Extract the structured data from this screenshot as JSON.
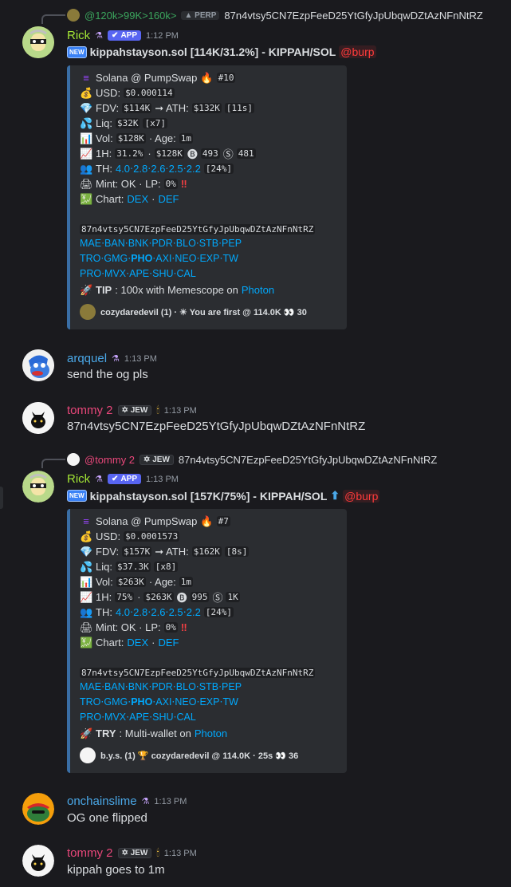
{
  "reply1": {
    "author": "@120k>99K>160k>",
    "badge": "PERP",
    "content": "87n4vtsy5CN7EzpFeeD25YtGfyJpUbqwDZtAzNFnNtRZ"
  },
  "msg1": {
    "author": "Rick",
    "badge": "APP",
    "time": "1:12 PM",
    "title_new": "NEW",
    "title": "kippahstayson.sol [114K/31.2%] - KIPPAH/SOL",
    "mention": "@burp",
    "embed": {
      "source": "Solana @ PumpSwap",
      "rank": "#10",
      "usd_label": "USD:",
      "usd": "$0.000114",
      "fdv_label": "FDV:",
      "fdv": "$114K",
      "ath_label": "➞ ATH:",
      "ath": "$132K",
      "ath_ago": "[11s]",
      "liq_label": "Liq:",
      "liq": "$32K",
      "liq_x": "[x7]",
      "vol_label": "Vol:",
      "vol": "$128K",
      "age_label": "· Age:",
      "age": "1m",
      "h1_label": "1H:",
      "h1_pct": "31.2%",
      "h1_vol": "$128K",
      "buys": "493",
      "sells": "481",
      "th_label": "TH:",
      "th": "4.0⋅2.8⋅2.6⋅2.5⋅2.2",
      "th_total": "[24%]",
      "mint_label": "Mint: OK · LP:",
      "lp": "0%",
      "chart_label": "Chart:",
      "dex": "DEX",
      "def": "DEF",
      "address": "87n4vtsy5CN7EzpFeeD25YtGfyJpUbqwDZtAzNFnNtRZ",
      "links1": "MAE⋅BAN⋅BNK⋅PDR⋅BLO⋅STB⋅PEP",
      "links2a": "TRO⋅GMG⋅",
      "links2b": "PHO",
      "links2c": "⋅AXI⋅NEO⋅EXP⋅TW",
      "links3": "PRO⋅MVX⋅APE⋅SHU⋅CAL",
      "tip_label": "TIP",
      "tip_text": ": 100x with Memescope on",
      "tip_link": "Photon",
      "footer": "cozydaredevil (1) · ☀ You are first @ 114.0K 👀 30"
    }
  },
  "msg2": {
    "author": "arqquel",
    "time": "1:13 PM",
    "content": "send the og pls"
  },
  "msg3": {
    "author": "tommy 2",
    "badge": "JEW",
    "time": "1:13 PM",
    "content": "87n4vtsy5CN7EzpFeeD25YtGfyJpUbqwDZtAzNFnNtRZ"
  },
  "reply2": {
    "author": "@tommy 2",
    "badge": "JEW",
    "content": "87n4vtsy5CN7EzpFeeD25YtGfyJpUbqwDZtAzNFnNtRZ"
  },
  "msg4": {
    "author": "Rick",
    "badge": "APP",
    "time": "1:13 PM",
    "title_new": "NEW",
    "title": "kippahstayson.sol [157K/75%] - KIPPAH/SOL",
    "arrow": "⬆",
    "mention": "@burp",
    "embed": {
      "source": "Solana @ PumpSwap",
      "rank": "#7",
      "usd_label": "USD:",
      "usd": "$0.0001573",
      "fdv_label": "FDV:",
      "fdv": "$157K",
      "ath_label": "➞ ATH:",
      "ath": "$162K",
      "ath_ago": "[8s]",
      "liq_label": "Liq:",
      "liq": "$37.3K",
      "liq_x": "[x8]",
      "vol_label": "Vol:",
      "vol": "$263K",
      "age_label": "· Age:",
      "age": "1m",
      "h1_label": "1H:",
      "h1_pct": "75%",
      "h1_vol": "$263K",
      "buys": "995",
      "sells": "1K",
      "th_label": "TH:",
      "th": "4.0⋅2.8⋅2.6⋅2.5⋅2.2",
      "th_total": "[24%]",
      "mint_label": "Mint: OK · LP:",
      "lp": "0%",
      "chart_label": "Chart:",
      "dex": "DEX",
      "def": "DEF",
      "address": "87n4vtsy5CN7EzpFeeD25YtGfyJpUbqwDZtAzNFnNtRZ",
      "links1": "MAE⋅BAN⋅BNK⋅PDR⋅BLO⋅STB⋅PEP",
      "links2a": "TRO⋅GMG⋅",
      "links2b": "PHO",
      "links2c": "⋅AXI⋅NEO⋅EXP⋅TW",
      "links3": "PRO⋅MVX⋅APE⋅SHU⋅CAL",
      "tip_label": "TRY",
      "tip_text": ": Multi-wallet on",
      "tip_link": "Photon",
      "footer": "b.y.s. (1) 🏆 cozydaredevil @ 114.0K · 25s 👀 36"
    }
  },
  "msg5": {
    "author": "onchainslime",
    "time": "1:13 PM",
    "content": "OG one flipped"
  },
  "msg6": {
    "author": "tommy 2",
    "badge": "JEW",
    "time": "1:13 PM",
    "content": "kippah goes to 1m"
  },
  "colors": {
    "rick": "#a3e635",
    "arqquel": "#4aa8e8",
    "tommy": "#e8477a",
    "onchainslime": "#4aa8e8",
    "accent": "#5865f2"
  }
}
